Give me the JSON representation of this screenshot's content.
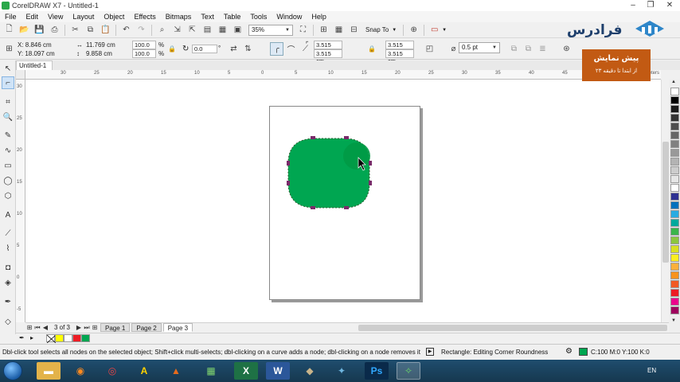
{
  "window": {
    "title": "CorelDRAW X7 - Untitled-1"
  },
  "menu": [
    "File",
    "Edit",
    "View",
    "Layout",
    "Object",
    "Effects",
    "Bitmaps",
    "Text",
    "Table",
    "Tools",
    "Window",
    "Help"
  ],
  "toolbar": {
    "zoom": "35%",
    "snap_label": "Snap To"
  },
  "property_bar": {
    "x": "X: 8.846 cm",
    "y": "Y: 18.097 cm",
    "width": "11.769 cm",
    "height": "9.858 cm",
    "scale_w": "100.0",
    "scale_h": "100.0",
    "percent": "%",
    "rotation": "0.0",
    "corner_tl": "3.515 cm",
    "corner_bl": "3.515 cm",
    "corner_tr": "3.515 cm",
    "corner_br": "3.515 cm",
    "outline_width": "0.5 pt"
  },
  "document_tab": "Untitled-1",
  "promo": {
    "line1": "پیش نمایش",
    "line2": "از ابتدا تا دقیقه ۲۳"
  },
  "brand": {
    "name": "فرادرس"
  },
  "rulers": {
    "units": "centimeters",
    "h_labels": [
      "30",
      "25",
      "20",
      "15",
      "10",
      "5",
      "0",
      "5",
      "10",
      "15",
      "20",
      "25",
      "30",
      "35",
      "40",
      "45",
      "50"
    ],
    "v_labels": [
      "30",
      "25",
      "20",
      "15",
      "10",
      "5",
      "0",
      "-5"
    ]
  },
  "page_nav": {
    "count": "3 of 3",
    "pages": [
      "Page 1",
      "Page 2",
      "Page 3"
    ],
    "active_page": "Page 3"
  },
  "shape": {
    "fill": "#00a651",
    "kind": "rounded rectangle"
  },
  "palette_colors": [
    "#ffffff",
    "#000000",
    "#1a1a1a",
    "#333333",
    "#4d4d4d",
    "#666666",
    "#808080",
    "#999999",
    "#b3b3b3",
    "#cccccc",
    "#e6e6e6",
    "#ffffff",
    "#2e3192",
    "#0071bc",
    "#29abe2",
    "#00a99d",
    "#39b54a",
    "#8cc63f",
    "#d9e021",
    "#fcee21",
    "#fbb03b",
    "#f7931e",
    "#f15a24",
    "#ed1c24",
    "#ec008c",
    "#9e005d"
  ],
  "doc_palette": [
    "#ffffff",
    "#ffff00",
    "#ffffff",
    "#ed1c24",
    "#00a651"
  ],
  "status": {
    "message": "Dbl-click tool selects all nodes on the selected object; Shift+click multi-selects; dbl-clicking on a curve adds a node; dbl-clicking on a node removes it",
    "object_desc": "Rectangle: Editing Corner Roundness",
    "fill_info": "C:100 M:0 Y:100 K:0"
  },
  "taskbar": {
    "language": "EN",
    "apps": [
      "explorer",
      "firefox",
      "chrome",
      "autocad",
      "matlab",
      "spreadsheet",
      "excel",
      "word",
      "gimp",
      "game",
      "photoshop",
      "coreldraw"
    ]
  },
  "colors": {
    "accent_green": "#00a651",
    "promo_bg": "#c25a13",
    "taskbar": "#1f4d6e"
  }
}
